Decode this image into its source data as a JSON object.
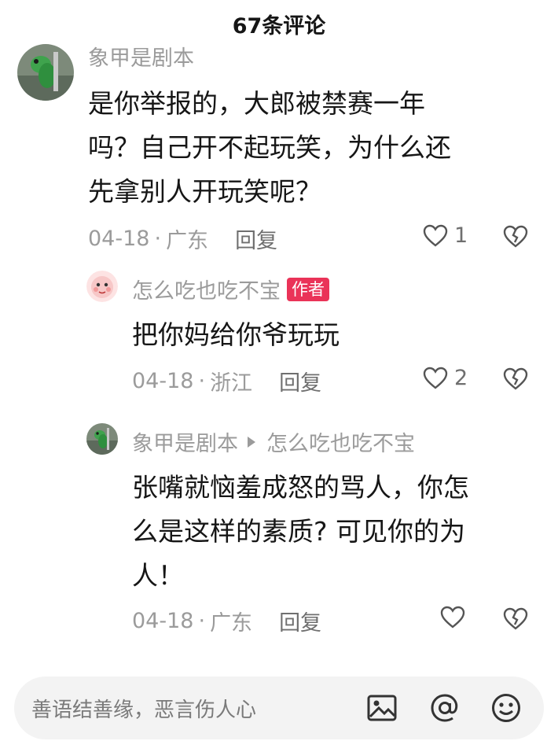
{
  "header": {
    "title": "67条评论"
  },
  "comments": [
    {
      "username": "象甲是剧本",
      "content": [
        "是你举报的，大郎被禁赛一年",
        "吗？自己开不起玩笑，为什么还",
        "先拿别人开玩笑呢？"
      ],
      "date": "04-18",
      "location": "广东",
      "reply_label": "回复",
      "like_count": "1"
    },
    {
      "username": "怎么吃也吃不宝",
      "badge": "作者",
      "content": [
        "把你妈给你爷玩玩"
      ],
      "date": "04-18",
      "location": "浙江",
      "reply_label": "回复",
      "like_count": "2"
    },
    {
      "username": "象甲是剧本",
      "reply_to": "怎么吃也吃不宝",
      "content": [
        "张嘴就恼羞成怒的骂人，你怎",
        "么是这样的素质? 可见你的为",
        "人！"
      ],
      "date": "04-18",
      "location": "广东",
      "reply_label": "回复",
      "like_count": ""
    }
  ],
  "input_bar": {
    "placeholder": "善语结善缘，恶言伤人心",
    "icons": [
      "image-icon",
      "at-icon",
      "emoji-icon"
    ]
  },
  "colors": {
    "text": "#161616",
    "muted": "#9b9b9b",
    "badge": "#ea3358",
    "input_bg": "#f3f3f3"
  }
}
